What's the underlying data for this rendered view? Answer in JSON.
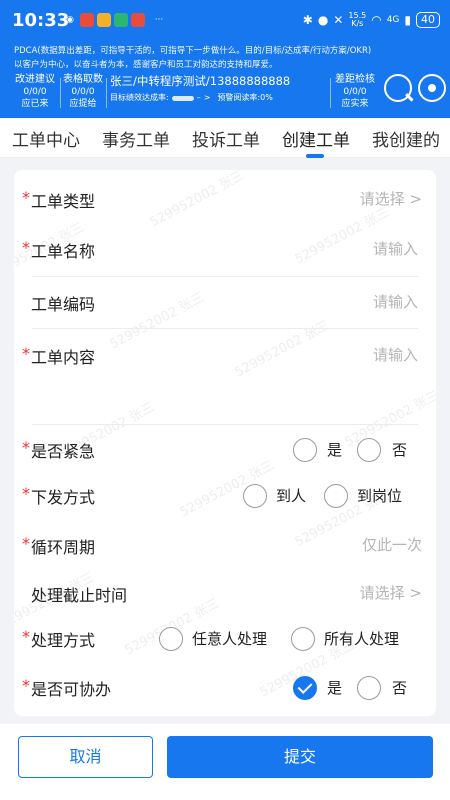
{
  "status_bar": {
    "time": "10:33",
    "net_speed": "15.5",
    "net_unit": "K/s",
    "signal": "4G",
    "battery": "40"
  },
  "header": {
    "pdca_line1": "PDCA(数据算出差距，可指导干活的，可指导下一步做什么。目的/目标/达成率/行动方案/OKR)",
    "pdca_line2": "以客户为中心，以奋斗者为本，感谢客户和员工对韵达的支持和厚爱。",
    "improve": {
      "title": "改进建议",
      "value": "0/0/0",
      "sub": "应已来"
    },
    "form_req": {
      "title": "表格取数",
      "value": "0/0/0",
      "sub": "应提给"
    },
    "user": "张三/中转程序测试/13888888888",
    "kpi_label": "目标绩效达成率:",
    "kpi_sep": "–",
    "kpi_arrow": ">",
    "warn_label": "预警阅读率:0%",
    "gap": {
      "title": "差距检核",
      "value": "0/0/0",
      "sub": "应实来"
    },
    "brand_color": "#1677ee"
  },
  "tabs": [
    {
      "label": "工单中心"
    },
    {
      "label": "事务工单"
    },
    {
      "label": "投诉工单"
    },
    {
      "label": "创建工单",
      "active": true
    },
    {
      "label": "我创建的"
    }
  ],
  "watermark": "529952002 张三",
  "form": {
    "ticket_type": {
      "label": "工单类型",
      "placeholder": "请选择 >"
    },
    "ticket_name": {
      "label": "工单名称",
      "placeholder": "请输入"
    },
    "ticket_code": {
      "label": "工单编码",
      "placeholder": "请输入"
    },
    "ticket_content": {
      "label": "工单内容",
      "placeholder": "请输入"
    },
    "urgent": {
      "label": "是否紧急",
      "options": [
        "是",
        "否"
      ]
    },
    "dispatch": {
      "label": "下发方式",
      "options": [
        "到人",
        "到岗位"
      ]
    },
    "cycle": {
      "label": "循环周期",
      "value": "仅此一次"
    },
    "deadline": {
      "label": "处理截止时间",
      "placeholder": "请选择 >"
    },
    "method": {
      "label": "处理方式",
      "options": [
        "任意人处理",
        "所有人处理"
      ]
    },
    "collab": {
      "label": "是否可协办",
      "options": [
        "是",
        "否"
      ],
      "selected": "是"
    }
  },
  "footer": {
    "cancel": "取消",
    "submit": "提交"
  }
}
